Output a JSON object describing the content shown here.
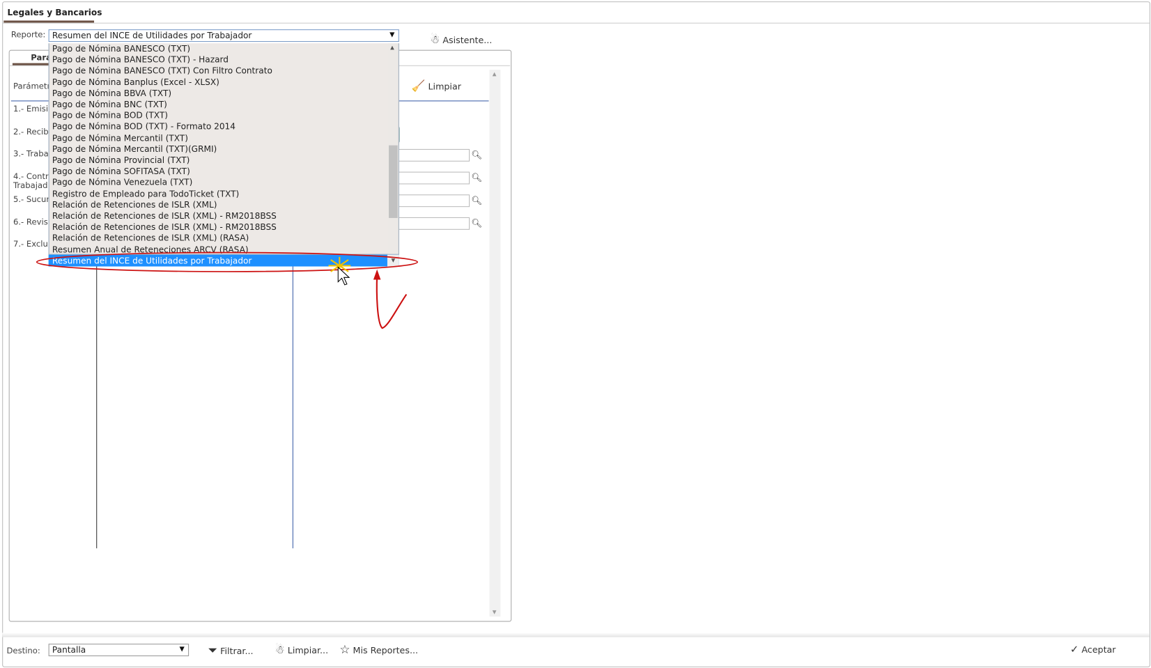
{
  "window": {
    "tab_title": "Legales y Bancarios"
  },
  "report": {
    "label": "Reporte:",
    "selected": "Resumen del INCE de Utilidades por Trabajador",
    "wizard_label": "Asistente..."
  },
  "panel": {
    "tab_label": "Pará",
    "params_label": "Parámetr",
    "clear_label": "Limpiar",
    "rows": [
      "1.- Emisi",
      "2.- Recib",
      "3.- Traba",
      "4.- Contr",
      "Trabajad",
      "5.- Sucur",
      "6.- Revis",
      "7.- Exclu"
    ]
  },
  "dropdown": {
    "options": [
      "Pago de Nómina BANESCO (TXT)",
      "Pago de Nómina BANESCO (TXT) - Hazard",
      "Pago de Nómina BANESCO (TXT) Con Filtro Contrato",
      "Pago de Nómina Banplus (Excel - XLSX)",
      "Pago de Nómina BBVA (TXT)",
      "Pago de Nómina BNC (TXT)",
      "Pago de Nómina BOD (TXT)",
      "Pago de Nómina BOD (TXT) - Formato 2014",
      "Pago de Nómina Mercantil (TXT)",
      "Pago de Nómina Mercantil (TXT)(GRMI)",
      "Pago de Nómina Provincial (TXT)",
      "Pago de Nómina SOFITASA (TXT)",
      "Pago de Nómina Venezuela (TXT)",
      "Registro de Empleado para TodoTicket (TXT)",
      "Relación de Retenciones de ISLR (XML)",
      "Relación de Retenciones de ISLR (XML) - RM2018BSS",
      "Relación de Retenciones de ISLR (XML) - RM2018BSS",
      "Relación de Retenciones de ISLR (XML) (RASA)",
      "Resumen Anual de Reteneciones ARCV (RASA)"
    ],
    "highlighted": "Resumen del INCE de Utilidades por Trabajador",
    "highlight_color": "#1e90ff",
    "annotation_color": "#cc1111"
  },
  "footer": {
    "dest_label": "Destino:",
    "dest_value": "Pantalla",
    "filter_label": "Filtrar...",
    "clear_label": "Limpiar...",
    "my_reports_label": "Mis Reportes...",
    "accept_label": "Aceptar"
  }
}
